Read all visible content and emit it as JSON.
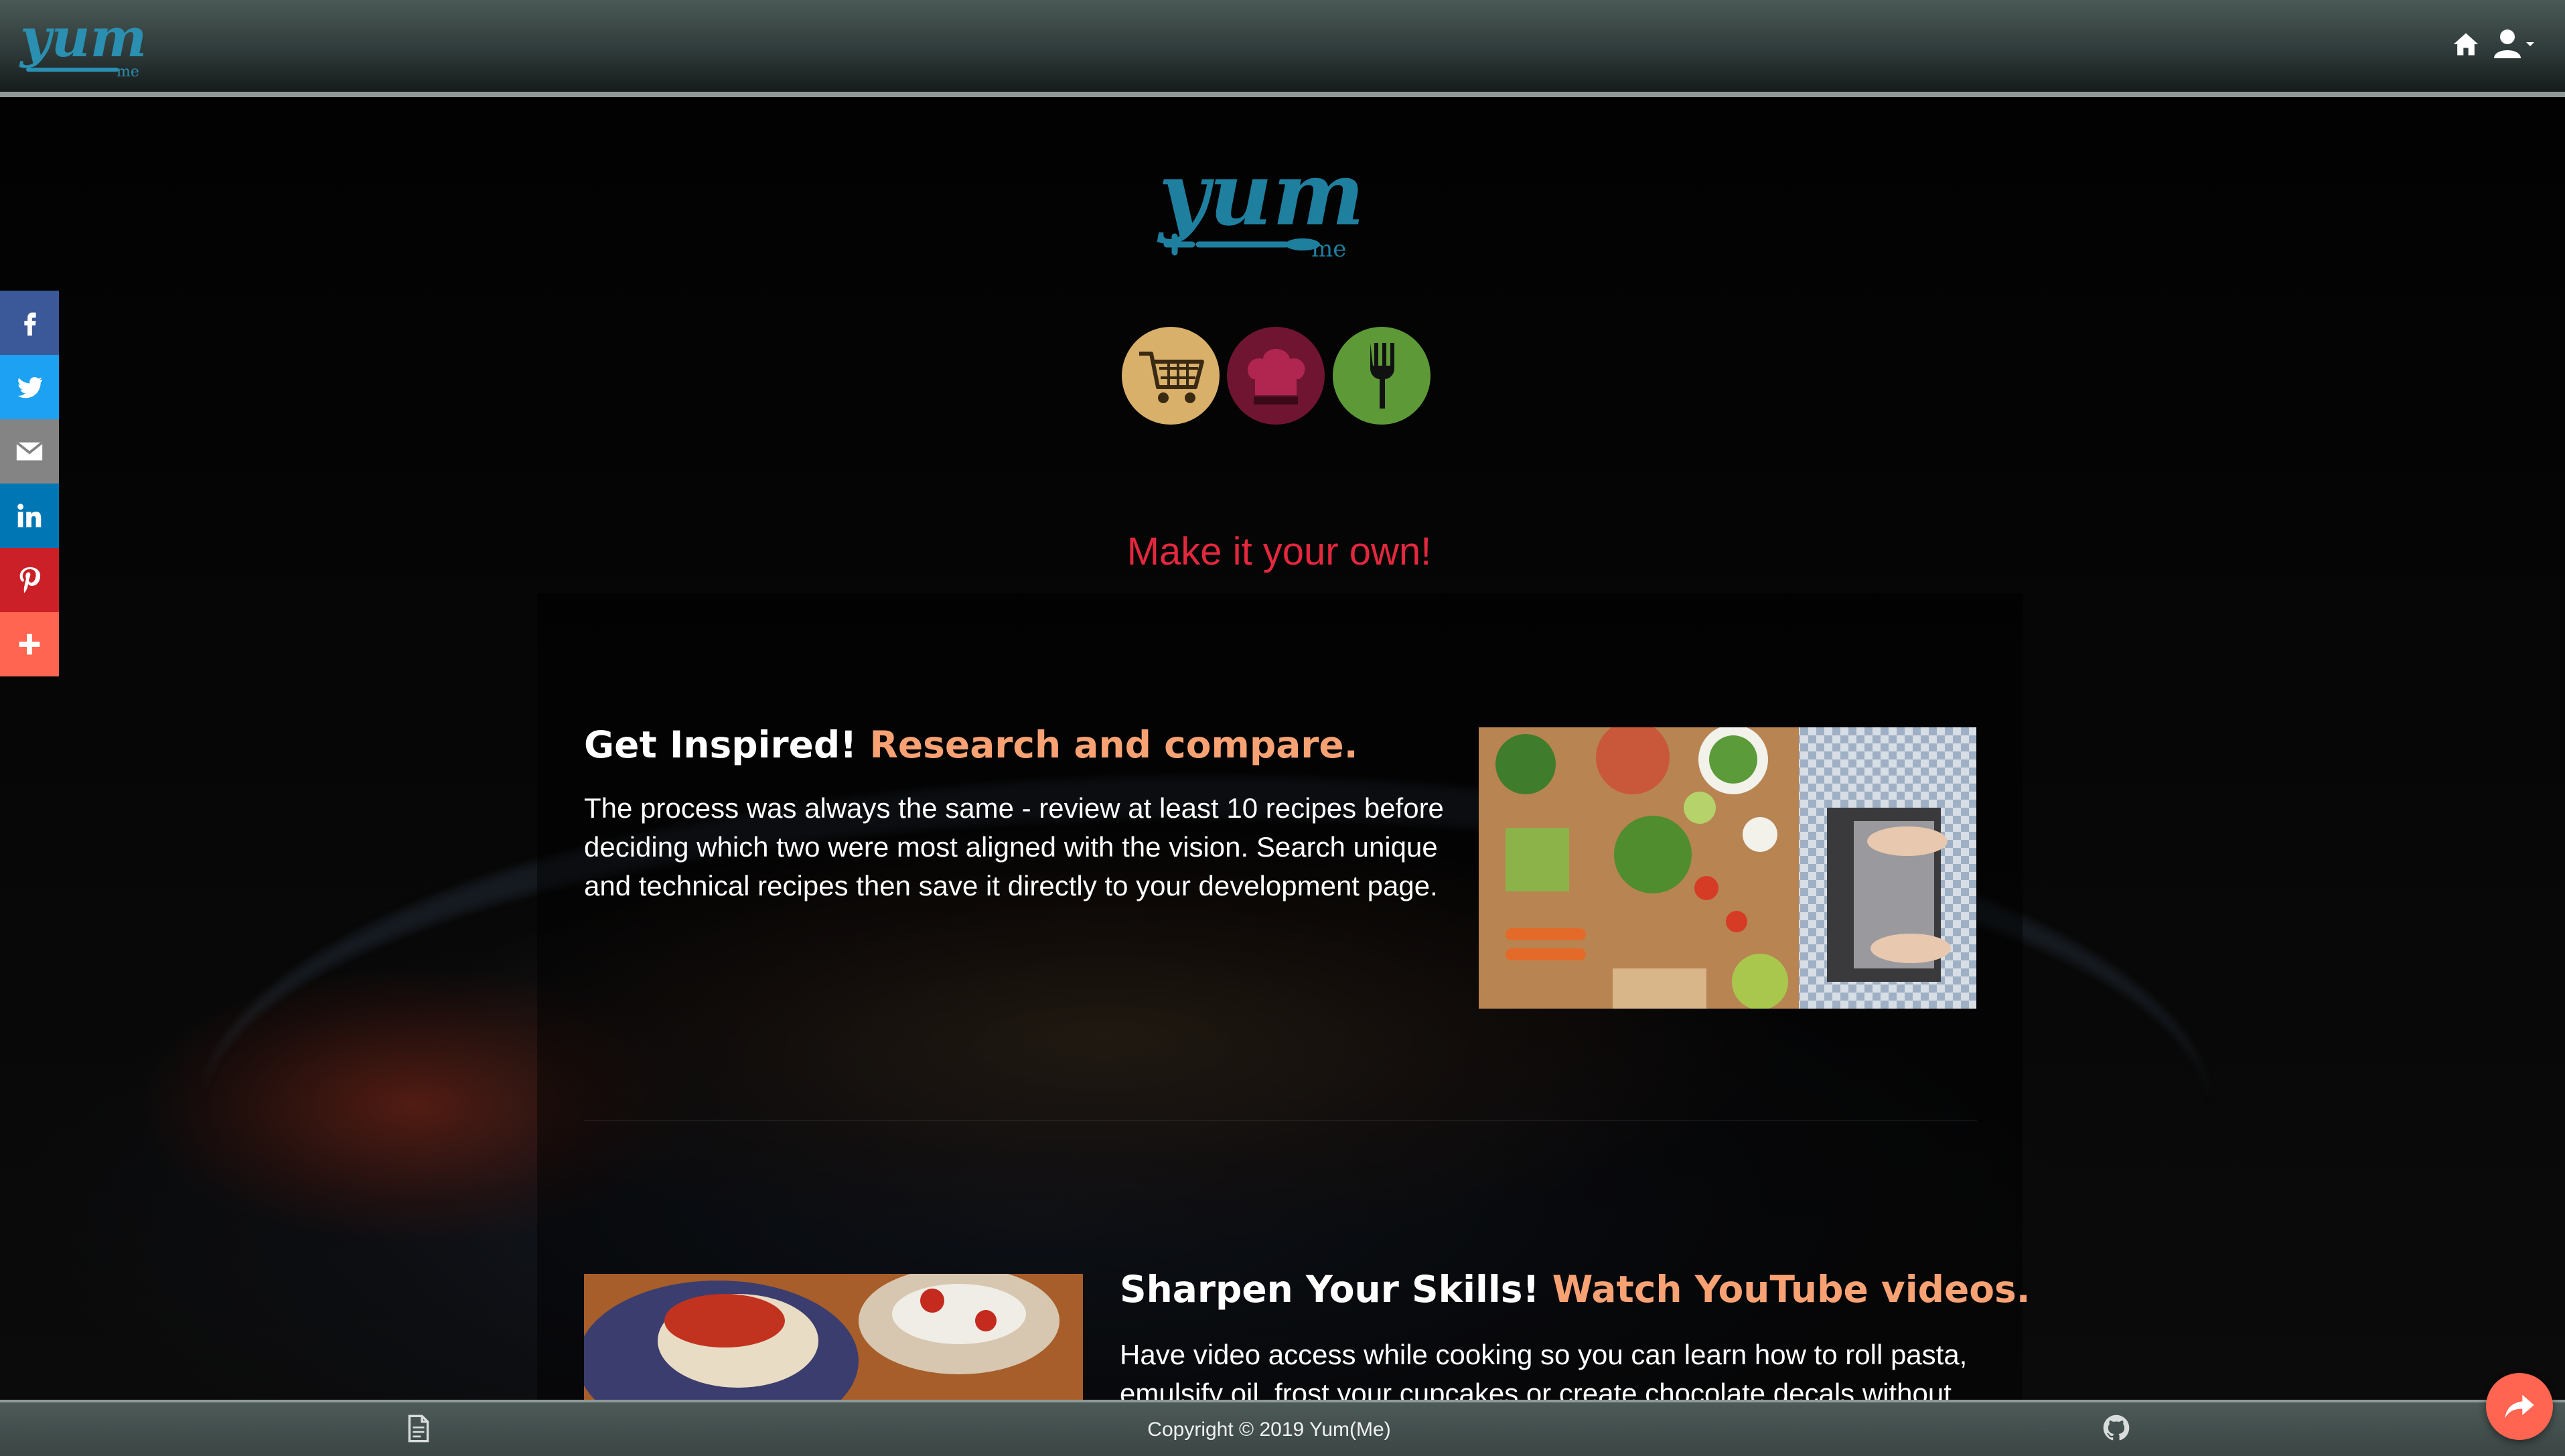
{
  "navbar": {
    "logo_text": "yum",
    "logo_sub": "me",
    "home_icon": "home-icon",
    "user_icon": "user-icon"
  },
  "hero": {
    "logo_text": "yum",
    "logo_sub": "me",
    "icons": [
      "shopping-cart-icon",
      "chef-hat-icon",
      "fork-icon"
    ],
    "tagline": "Make it your own!"
  },
  "share_bar": {
    "items": [
      "facebook-icon",
      "twitter-icon",
      "email-icon",
      "linkedin-icon",
      "pinterest-icon",
      "plus-icon"
    ],
    "colors": {
      "facebook": "#3b5998",
      "twitter": "#1da1f2",
      "email": "#848484",
      "linkedin": "#0077b5",
      "pinterest": "#cb2027",
      "more": "#ff6550"
    }
  },
  "sections": [
    {
      "heading_main": "Get Inspired!",
      "heading_accent": "Research and compare.",
      "body": "The process was always the same - review at least 10 recipes before deciding which two were most aligned with the vision. Search unique and technical recipes then save it directly to your development page."
    },
    {
      "heading_main": "Sharpen Your Skills!",
      "heading_accent": "Watch YouTube videos.",
      "body": "Have video access while cooking so you can learn how to roll pasta, emulsify oil, frost your cupcakes or create chocolate decals without"
    }
  ],
  "footer": {
    "copyright": "Copyright © 2019 Yum(Me)",
    "doc_icon": "document-icon",
    "github_icon": "github-icon",
    "fab_icon": "share-icon"
  },
  "colors": {
    "accent": "#f8a273",
    "tagline": "#e3283d",
    "brand_teal": "#2a8fb0"
  }
}
